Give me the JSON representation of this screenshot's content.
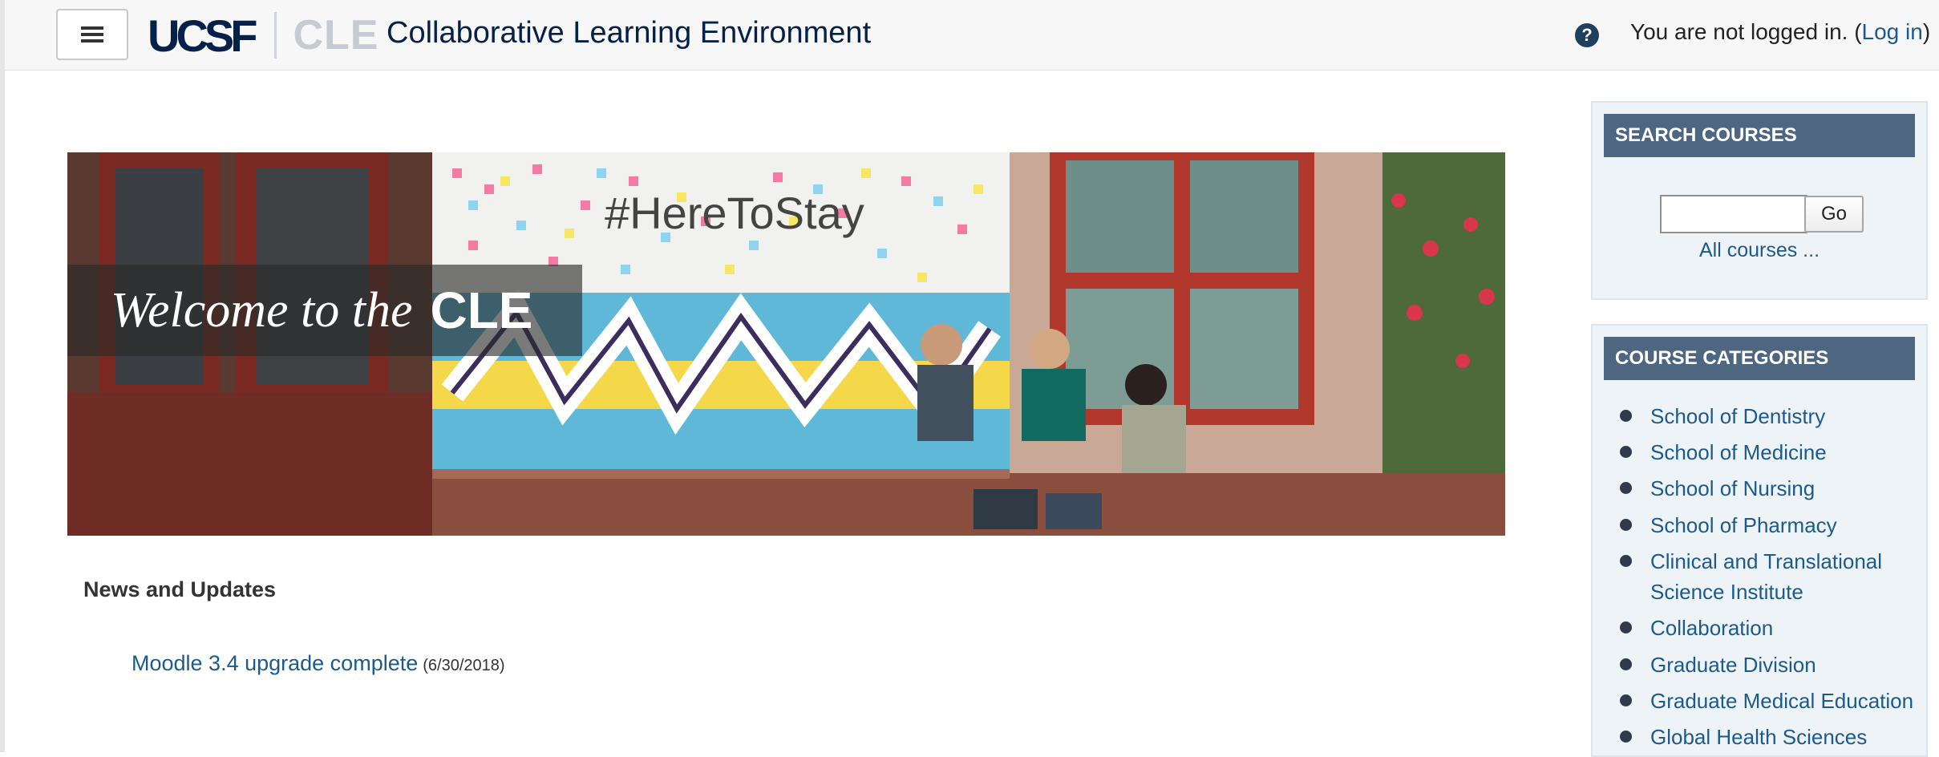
{
  "navbar": {
    "logo_ucsf": "UCSF",
    "logo_cle": "CLE",
    "site_title": "Collaborative Learning Environment",
    "login_text": "You are not logged in. (",
    "login_link": "Log in",
    "login_close": ")"
  },
  "banner": {
    "welcome_script": "Welcome to the",
    "welcome_cle": "CLE",
    "sign_text": "#HereToStay"
  },
  "news": {
    "heading": "News and Updates",
    "item_title": "Moodle 3.4 upgrade complete",
    "item_date": "(6/30/2018)"
  },
  "search_block": {
    "header": "SEARCH COURSES",
    "go_label": "Go",
    "all_courses": "All courses ..."
  },
  "categories_block": {
    "header": "COURSE CATEGORIES",
    "items": [
      {
        "label": "School of Dentistry"
      },
      {
        "label": "School of Medicine"
      },
      {
        "label": "School of Nursing"
      },
      {
        "label": "School of Pharmacy"
      },
      {
        "label": "Clinical and Translational Science Institute"
      },
      {
        "label": "Collaboration"
      },
      {
        "label": "Graduate Division"
      },
      {
        "label": "Graduate Medical Education"
      },
      {
        "label": "Global Health Sciences"
      }
    ]
  },
  "colors": {
    "navy": "#052049",
    "link": "#1c5a8c",
    "block_header": "#4e6680",
    "block_bg": "#eef3f7"
  }
}
